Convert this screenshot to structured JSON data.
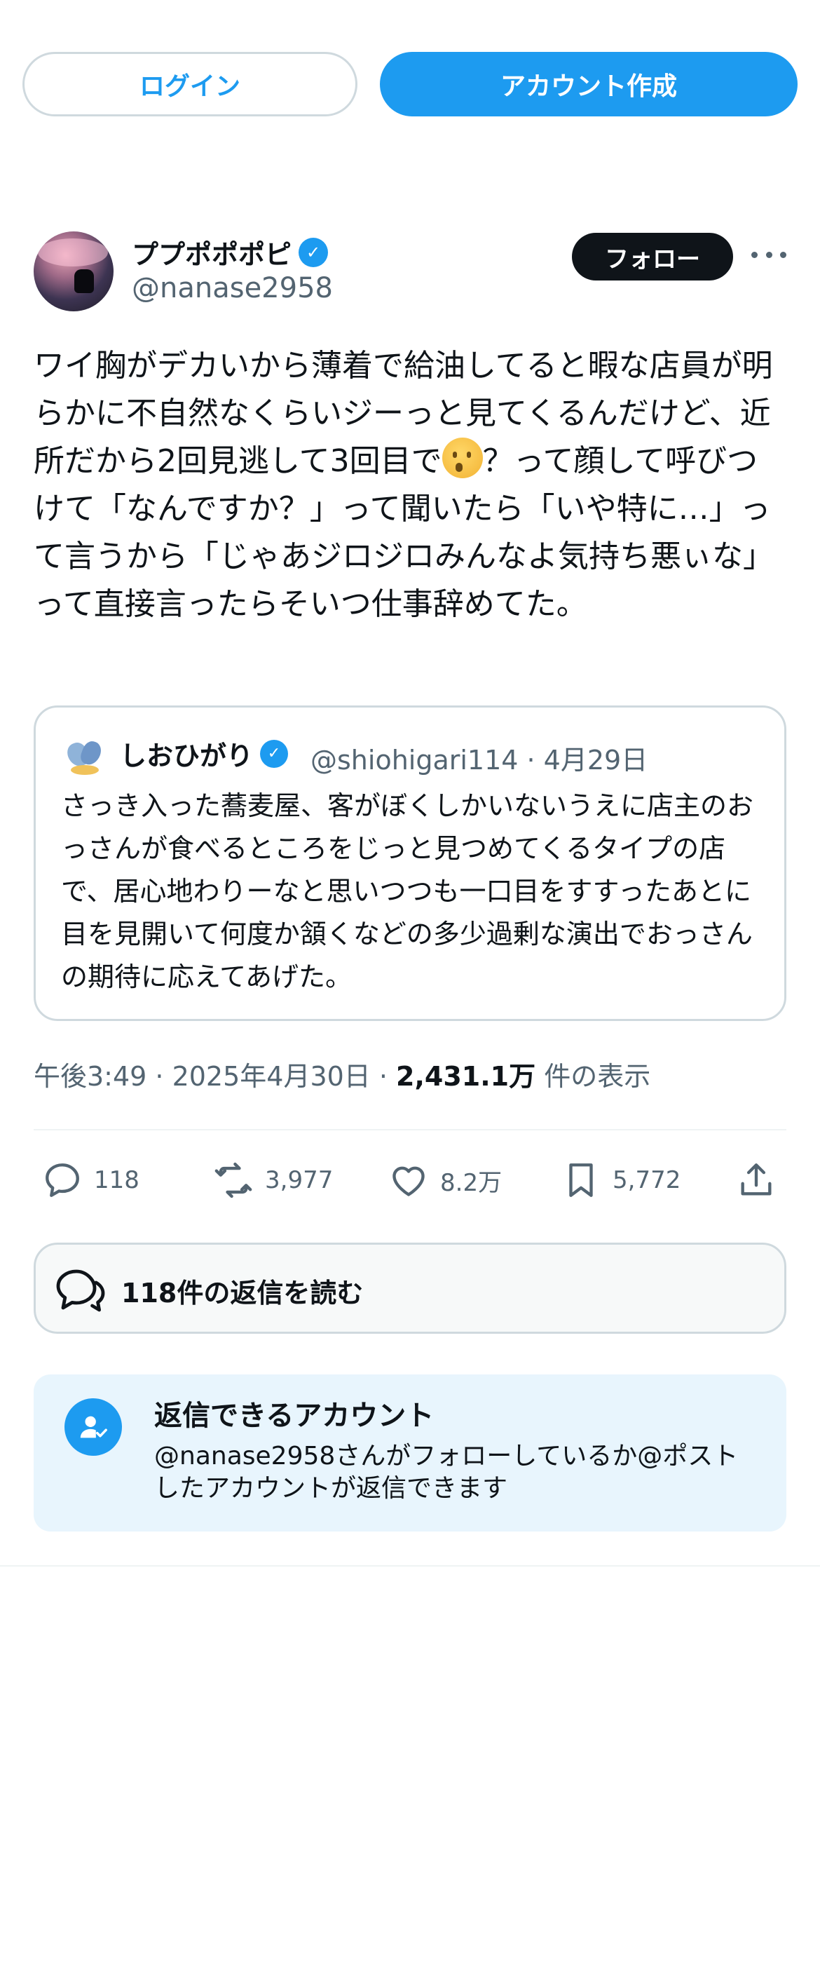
{
  "top_bar": {
    "login_label": "ログイン",
    "signup_label": "アカウント作成"
  },
  "author": {
    "display_name": "ププポポポピ",
    "handle": "@nanase2958",
    "follow_label": "フォロー",
    "verified_mark": "✓"
  },
  "tweet": {
    "text_before_emoji": "ワイ胸がデカいから薄着で給油してると暇な店員が明らかに不自然なくらいジーっと見てくるんだけど、近所だから2回見逃して3回目で",
    "emoji_icon": "face-with-raised-eyebrow",
    "text_after_emoji": "？って顔して呼びつけて「なんですか？」って聞いたら「いや特に…」って言うから「じゃあジロジロみんなよ気持ち悪ぃな」って直接言ったらそいつ仕事辞めてた。"
  },
  "quote": {
    "display_name": "しおひがり",
    "verified_mark": "✓",
    "handle_date": "@shiohigari114 · 4月29日",
    "text": "さっき入った蕎麦屋、客がぼくしかいないうえに店主のおっさんが食べるところをじっと見つめてくるタイプの店で、居心地わりーなと思いつつも一口目をすすったあとに目を見開いて何度か頷くなどの多少過剰な演出でおっさんの期待に応えてあげた。"
  },
  "meta": {
    "time_date": "午後3:49 · 2025年4月30日 · ",
    "views": "2,431.1万",
    "views_suffix": " 件の表示"
  },
  "actions": {
    "replies": "118",
    "retweets": "3,977",
    "likes": "8.2万",
    "bookmarks": "5,772"
  },
  "read_replies": {
    "label": "118件の返信を読む"
  },
  "reply_restriction": {
    "title": "返信できるアカウント",
    "body": "@nanase2958さんがフォローしているか@ポストしたアカウントが返信できます"
  },
  "colors": {
    "accent": "#1d9bf0",
    "text": "#0f1419",
    "secondary": "#536471",
    "border": "#cfd9de",
    "info_bg": "#e8f5fd"
  }
}
